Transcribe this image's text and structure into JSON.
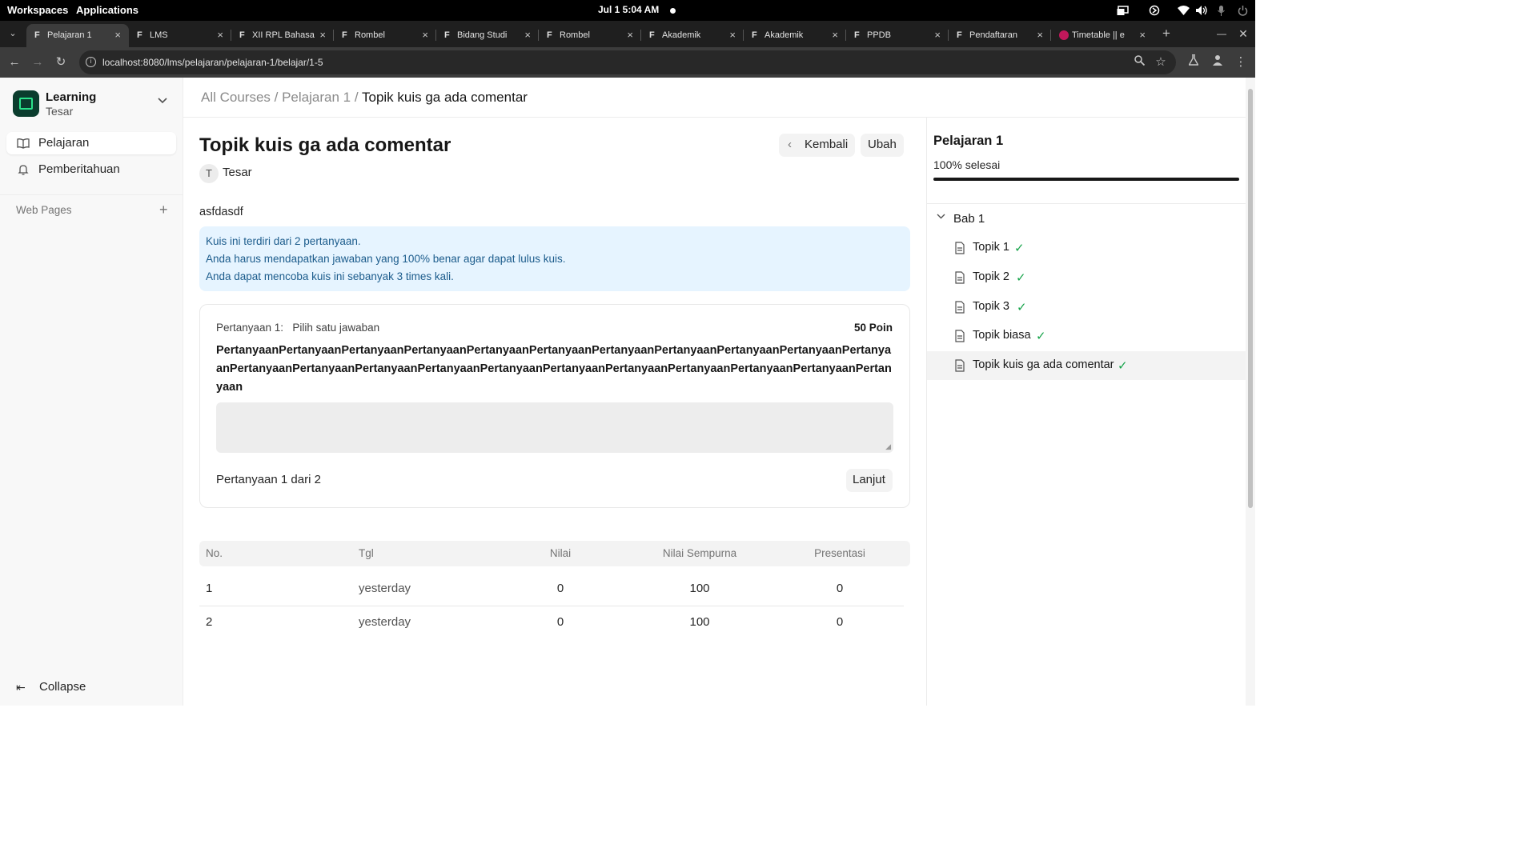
{
  "system_bar": {
    "workspaces": "Workspaces",
    "applications": "Applications",
    "clock": "Jul 1  5:04 AM"
  },
  "browser": {
    "tabs": [
      {
        "label": "Pelajaran 1",
        "icon": "frappe-icon",
        "active": true
      },
      {
        "label": "LMS",
        "icon": "frappe-icon"
      },
      {
        "label": "XII RPL Bahasa",
        "icon": "frappe-icon"
      },
      {
        "label": "Rombel",
        "icon": "frappe-icon"
      },
      {
        "label": "Bidang Studi",
        "icon": "frappe-icon"
      },
      {
        "label": "Rombel",
        "icon": "frappe-icon"
      },
      {
        "label": "Akademik",
        "icon": "frappe-icon"
      },
      {
        "label": "Akademik",
        "icon": "frappe-icon"
      },
      {
        "label": "PPDB",
        "icon": "frappe-icon"
      },
      {
        "label": "Pendaftaran",
        "icon": "frappe-icon"
      },
      {
        "label": "Timetable || e",
        "icon": "timetable-icon"
      }
    ],
    "url": "localhost:8080/lms/pelajaran/pelajaran-1/belajar/1-5"
  },
  "sidebar": {
    "brand_title": "Learning",
    "brand_subtitle": "Tesar",
    "items": [
      {
        "label": "Pelajaran",
        "icon": "book-icon",
        "active": true
      },
      {
        "label": "Pemberitahuan",
        "icon": "bell-icon"
      }
    ],
    "section_label": "Web Pages",
    "collapse_label": "Collapse"
  },
  "breadcrumb": {
    "crumb1": "All Courses",
    "crumb2": "Pelajaran 1",
    "current": "Topik kuis ga ada comentar",
    "separator": " / "
  },
  "lesson": {
    "title": "Topik kuis ga ada comentar",
    "author_initial": "T",
    "author_name": "Tesar",
    "back_label": "Kembali",
    "edit_label": "Ubah",
    "description": "asfdasdf",
    "info_lines": [
      "Kuis ini terdiri dari 2 pertanyaan.",
      "Anda harus mendapatkan jawaban yang 100% benar agar dapat lulus kuis.",
      "Anda dapat mencoba kuis ini sebanyak 3 times kali."
    ]
  },
  "question": {
    "label": "Pertanyaan 1:",
    "type": "Pilih satu jawaban",
    "points": "50 Poin",
    "text": "PertanyaanPertanyaanPertanyaanPertanyaanPertanyaanPertanyaanPertanyaanPertanyaanPertanyaanPertanyaanPertanyaanPertanyaanPertanyaanPertanyaanPertanyaanPertanyaanPertanyaanPertanyaanPertanyaanPertanyaanPertanyaanPertanyaan",
    "answer_value": "",
    "counter": "Pertanyaan 1 dari 2",
    "next_label": "Lanjut"
  },
  "attempts": {
    "headers": [
      "No.",
      "Tgl",
      "Nilai",
      "Nilai Sempurna",
      "Presentasi"
    ],
    "rows": [
      [
        "1",
        "yesterday",
        "0",
        "100",
        "0"
      ],
      [
        "2",
        "yesterday",
        "0",
        "100",
        "0"
      ]
    ]
  },
  "course_panel": {
    "title": "Pelajaran 1",
    "progress_text": "100% selesai",
    "progress": 1.0,
    "chapter": "Bab 1",
    "topics": [
      {
        "label": "Topik 1",
        "done": true
      },
      {
        "label": "Topik 2",
        "done": true
      },
      {
        "label": "Topik 3",
        "done": true
      },
      {
        "label": "Topik biasa",
        "done": true
      },
      {
        "label": "Topik kuis ga ada comentar",
        "done": true,
        "active": true
      }
    ]
  },
  "colors": {
    "brand": "#0b3d2e",
    "brand_accent": "#2ae28a",
    "info_bg": "#e6f4ff",
    "info_text": "#1c5c8c",
    "check": "#16a34a"
  }
}
